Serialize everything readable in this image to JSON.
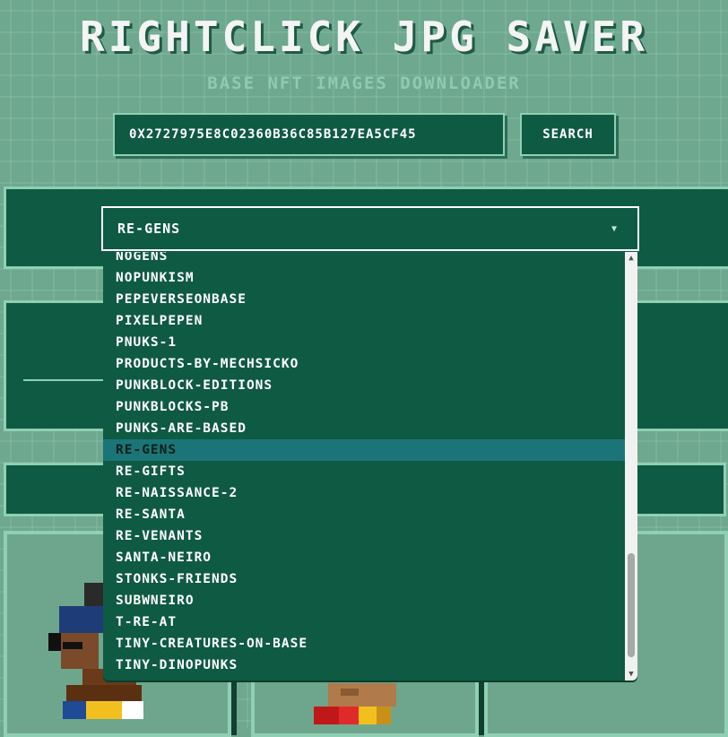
{
  "header": {
    "title": "RIGHTCLICK JPG SAVER",
    "subtitle": "BASE NFT IMAGES DOWNLOADER"
  },
  "search": {
    "value": "0X2727975E8C02360B36C85B127EA5CF45",
    "button_label": "SEARCH"
  },
  "collection_select": {
    "selected": "RE-GENS",
    "options": [
      "NOGENS",
      "NOPUNKISM",
      "PEPEVERSEONBASE",
      "PIXELPEPEN",
      "PNUKS-1",
      "PRODUCTS-BY-MECHSICKO",
      "PUNKBLOCK-EDITIONS",
      "PUNKBLOCKS-PB",
      "PUNKS-ARE-BASED",
      "RE-GENS",
      "RE-GIFTS",
      "RE-NAISSANCE-2",
      "RE-SANTA",
      "RE-VENANTS",
      "SANTA-NEIRO",
      "STONKS-FRIENDS",
      "SUBWNEIRO",
      "T-RE-AT",
      "TINY-CREATURES-ON-BASE",
      "TINY-DINOPUNKS"
    ],
    "scroll_position": 0.82
  },
  "colors": {
    "background": "#5f9a82",
    "panel": "#0f5a42",
    "border": "#8fd0b4",
    "highlight": "#1b7578"
  },
  "icons": {
    "dropdown": "chevron-down-icon",
    "scroll_up": "triangle-up-icon",
    "scroll_down": "triangle-down-icon"
  }
}
